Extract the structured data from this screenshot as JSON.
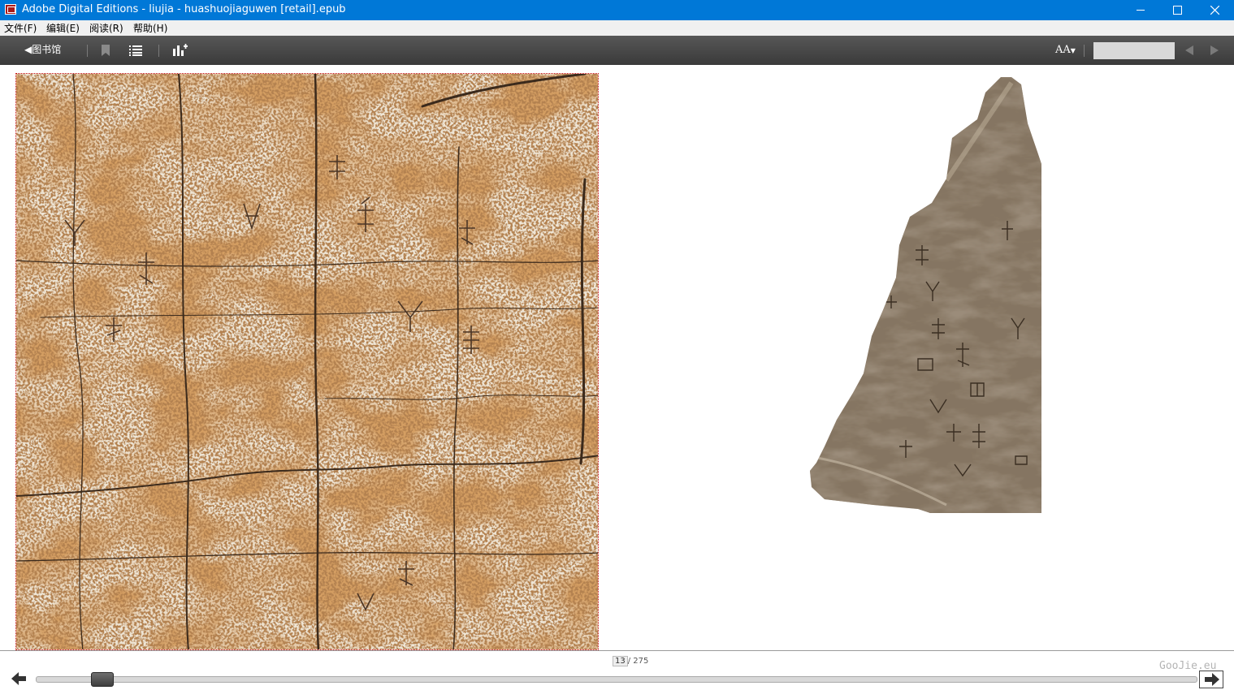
{
  "window": {
    "title": "Adobe Digital Editions - liujia - huashuojiaguwen [retail].epub"
  },
  "menu": {
    "items": [
      "文件(F)",
      "编辑(E)",
      "阅读(R)",
      "帮助(H)"
    ]
  },
  "toolbar": {
    "library_label": "◀图书馆",
    "font_size_label": "AA",
    "icons": [
      "bookmark-icon",
      "contents-list-icon",
      "reading-stats-icon",
      "font-size-icon",
      "prev-result-icon",
      "next-result-icon"
    ]
  },
  "search": {
    "value": ""
  },
  "footer": {
    "current_page": "13",
    "total_pages": "/ 275",
    "watermark": "GooJie.eu"
  },
  "reading_progress": {
    "position": 13,
    "total": 275
  },
  "colors": {
    "titlebar": "#0078d7",
    "toolbar": "#474747",
    "page_border": "#c00000"
  }
}
